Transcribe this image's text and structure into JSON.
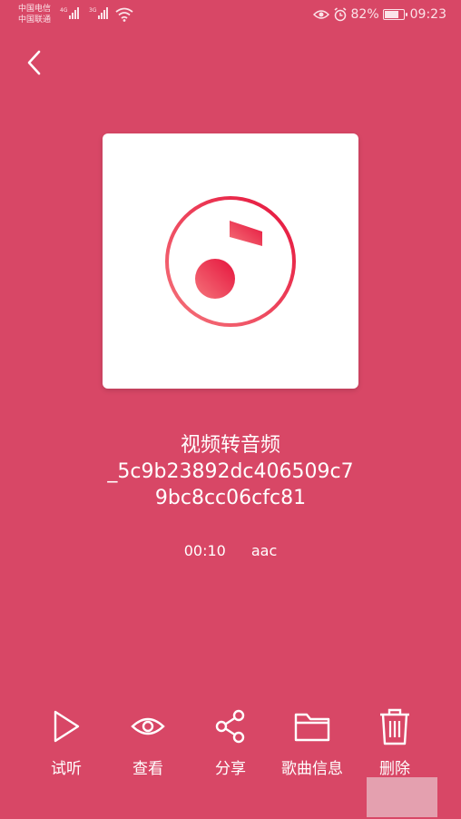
{
  "status_bar": {
    "carrier1": "中国电信",
    "carrier2": "中国联通",
    "net1": "4G",
    "net2": "3G",
    "battery_percent": "82%",
    "battery_level": 0.82,
    "time": "09:23"
  },
  "back_icon": "chevron-left-icon",
  "cover_icon": "music-note-icon",
  "song": {
    "title_line1": "视频转音频",
    "title_line2": "_5c9b23892dc406509c7",
    "title_line3": "9bc8cc06cfc81",
    "duration": "00:10",
    "format": "aac"
  },
  "actions": [
    {
      "label": "试听",
      "icon": "play-icon"
    },
    {
      "label": "查看",
      "icon": "eye-icon"
    },
    {
      "label": "分享",
      "icon": "share-icon"
    },
    {
      "label": "歌曲信息",
      "icon": "folder-icon"
    },
    {
      "label": "删除",
      "icon": "trash-icon"
    }
  ],
  "colors": {
    "background": "#d84766",
    "accent_gradient_start": "#f5747b",
    "accent_gradient_end": "#e5133c"
  }
}
